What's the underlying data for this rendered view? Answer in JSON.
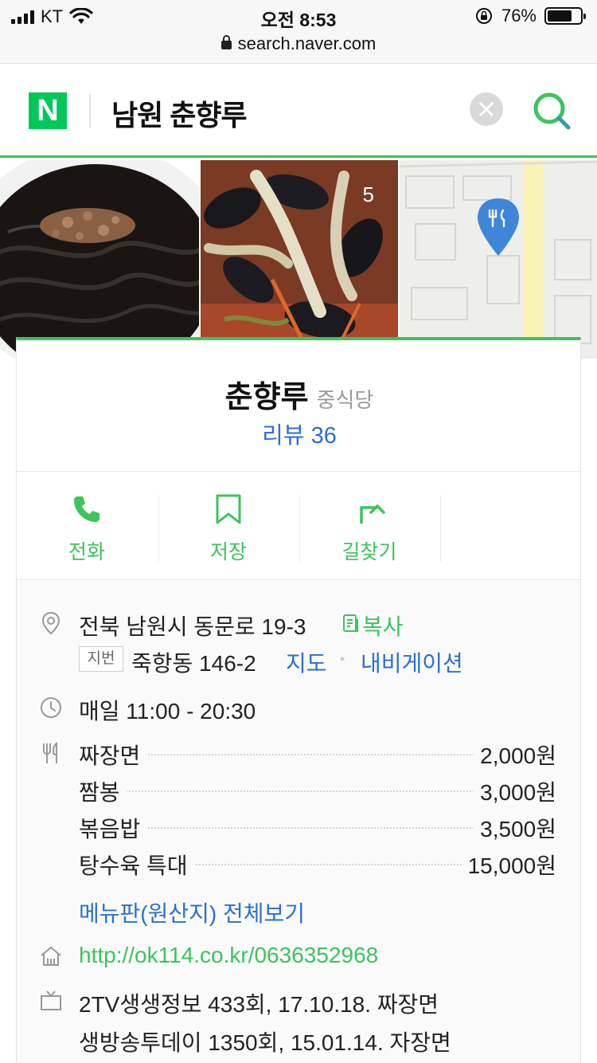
{
  "status_bar": {
    "carrier": "KT",
    "time": "오전 8:53",
    "battery_percent": "76%",
    "battery_level": 0.76
  },
  "url_bar": {
    "url": "search.naver.com"
  },
  "search": {
    "logo": "N",
    "query": "남원 춘향루",
    "clear_icon": "close-icon",
    "search_icon": "search-icon",
    "accent": "#3bc55a"
  },
  "photos": {
    "photo_count": "5"
  },
  "place": {
    "name": "춘향루",
    "category": "중식당",
    "review": "리뷰 36"
  },
  "actions": [
    {
      "label": "전화",
      "icon": "phone-icon"
    },
    {
      "label": "저장",
      "icon": "bookmark-icon"
    },
    {
      "label": "길찾기",
      "icon": "directions-icon"
    }
  ],
  "info": {
    "address": "전북 남원시 동문로 19-3",
    "copy": "복사",
    "jibun_badge": "지번",
    "jibun": "죽항동 146-2",
    "map": "지도",
    "navigation": "내비게이션",
    "hours": "매일 11:00 - 20:30",
    "menu": [
      {
        "name": "짜장면",
        "price": "2,000원"
      },
      {
        "name": "짬봉",
        "price": "3,000원"
      },
      {
        "name": "볶음밥",
        "price": "3,500원"
      },
      {
        "name": "탕수육 특대",
        "price": "15,000원"
      }
    ],
    "menu_more": "메뉴판(원산지) 전체보기",
    "homepage": "http://ok114.co.kr/0636352968",
    "tv": [
      "2TV생생정보 433회, 17.10.18. 짜장면",
      "생방송투데이 1350회, 15.01.14. 자장면"
    ]
  }
}
